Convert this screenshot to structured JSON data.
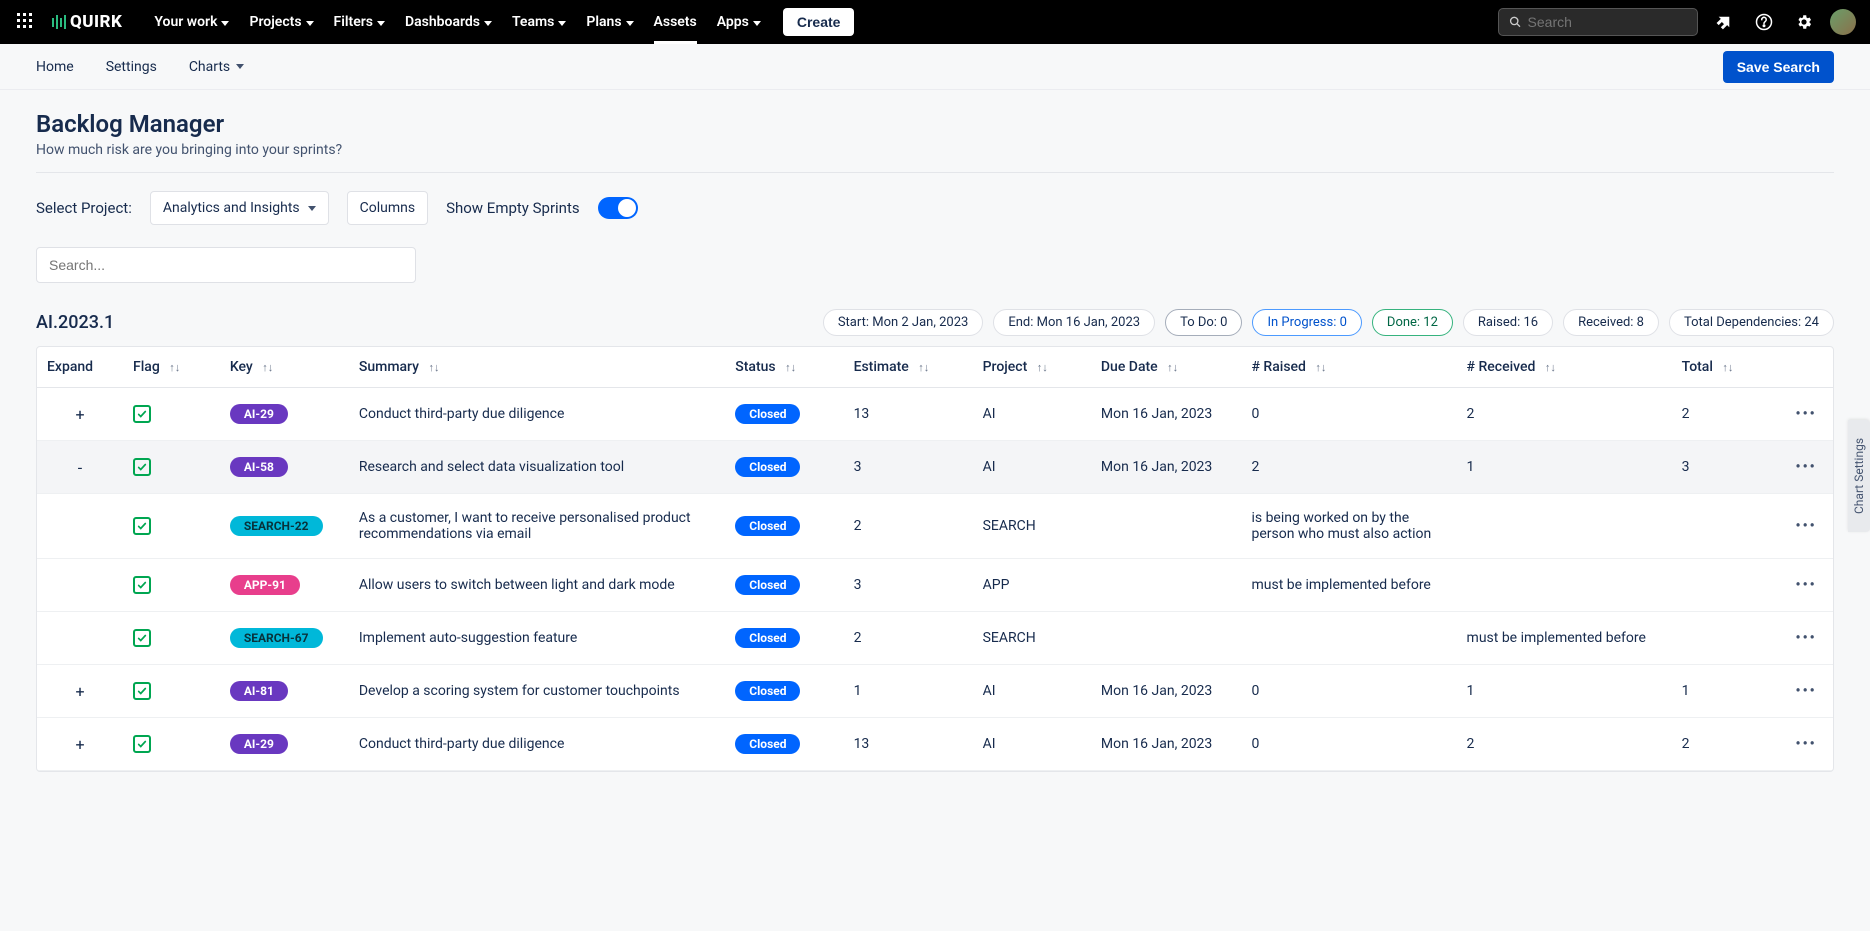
{
  "brand": "QUIRK",
  "topnav": {
    "items": [
      "Your work",
      "Projects",
      "Filters",
      "Dashboards",
      "Teams",
      "Plans",
      "Assets",
      "Apps"
    ],
    "dropdown": [
      true,
      true,
      true,
      true,
      true,
      true,
      false,
      true
    ],
    "active_index": 6,
    "create": "Create",
    "search_placeholder": "Search"
  },
  "secondbar": {
    "tabs": [
      "Home",
      "Settings",
      "Charts"
    ],
    "save": "Save Search"
  },
  "page": {
    "title": "Backlog Manager",
    "subtitle": "How much risk are you bringing into your sprints?"
  },
  "controls": {
    "select_label": "Select Project:",
    "project": "Analytics and Insights",
    "columns": "Columns",
    "toggle_label": "Show Empty Sprints",
    "search_placeholder": "Search..."
  },
  "sprint": {
    "name": "AI.2023.1",
    "pills": [
      {
        "cls": "",
        "text": "Start: Mon 2 Jan, 2023"
      },
      {
        "cls": "",
        "text": "End: Mon 16 Jan, 2023"
      },
      {
        "cls": "todo",
        "text": "To Do: 0"
      },
      {
        "cls": "inprog",
        "text": "In Progress: 0"
      },
      {
        "cls": "done",
        "text": "Done: 12"
      },
      {
        "cls": "",
        "text": "Raised: 16"
      },
      {
        "cls": "",
        "text": "Received: 8"
      },
      {
        "cls": "",
        "text": "Total Dependencies: 24"
      }
    ]
  },
  "columns": [
    "Expand",
    "Flag",
    "Key",
    "Summary",
    "Status",
    "Estimate",
    "Project",
    "Due Date",
    "# Raised",
    "# Received",
    "Total"
  ],
  "sortable": [
    false,
    true,
    true,
    true,
    true,
    true,
    true,
    true,
    true,
    true,
    true
  ],
  "rows": [
    {
      "expand": "+",
      "key": "AI-29",
      "key_cls": "key-ai",
      "summary": "Conduct third-party due diligence",
      "status": "Closed",
      "estimate": "13",
      "project": "AI",
      "due": "Mon 16 Jan, 2023",
      "raised": "0",
      "received": "2",
      "total": "2",
      "sub": false,
      "hl": false
    },
    {
      "expand": "-",
      "key": "AI-58",
      "key_cls": "key-ai",
      "summary": "Research and select data visualization tool",
      "status": "Closed",
      "estimate": "3",
      "project": "AI",
      "due": "Mon 16 Jan, 2023",
      "raised": "2",
      "received": "1",
      "total": "3",
      "sub": false,
      "hl": true
    },
    {
      "expand": "",
      "key": "SEARCH-22",
      "key_cls": "key-search",
      "summary": "As a customer, I want to receive personalised product recommendations via email",
      "status": "Closed",
      "estimate": "2",
      "project": "SEARCH",
      "due": "",
      "raised": "is being worked on by the person who must also action",
      "received": "",
      "total": "",
      "sub": true,
      "hl": false
    },
    {
      "expand": "",
      "key": "APP-91",
      "key_cls": "key-app",
      "summary": "Allow users to switch between light and dark mode",
      "status": "Closed",
      "estimate": "3",
      "project": "APP",
      "due": "",
      "raised": "must be implemented before",
      "received": "",
      "total": "",
      "sub": true,
      "hl": false
    },
    {
      "expand": "",
      "key": "SEARCH-67",
      "key_cls": "key-search",
      "summary": "Implement auto-suggestion feature",
      "status": "Closed",
      "estimate": "2",
      "project": "SEARCH",
      "due": "",
      "raised": "",
      "received": "must be implemented before",
      "total": "",
      "sub": true,
      "hl": false
    },
    {
      "expand": "+",
      "key": "AI-81",
      "key_cls": "key-ai",
      "summary": "Develop a scoring system for customer touchpoints",
      "status": "Closed",
      "estimate": "1",
      "project": "AI",
      "due": "Mon 16 Jan, 2023",
      "raised": "0",
      "received": "1",
      "total": "1",
      "sub": false,
      "hl": false
    },
    {
      "expand": "+",
      "key": "AI-29",
      "key_cls": "key-ai",
      "summary": "Conduct third-party due diligence",
      "status": "Closed",
      "estimate": "13",
      "project": "AI",
      "due": "Mon 16 Jan, 2023",
      "raised": "0",
      "received": "2",
      "total": "2",
      "sub": false,
      "hl": false
    }
  ],
  "side_tab": "Chart Settings"
}
